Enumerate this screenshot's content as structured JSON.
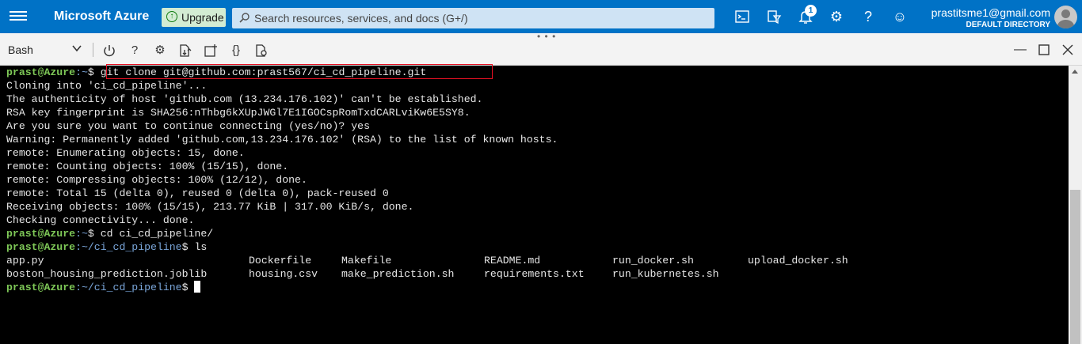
{
  "topbar": {
    "brand": "Microsoft Azure",
    "upgrade_label": "Upgrade",
    "search_placeholder": "Search resources, services, and docs (G+/)",
    "notification_count": "1",
    "account_email": "prastitsme1@gmail.com",
    "account_directory": "DEFAULT DIRECTORY",
    "icons": [
      "menu-icon",
      "cloud-shell-icon",
      "directory-filter-icon",
      "notifications-icon",
      "settings-icon",
      "help-icon",
      "feedback-icon",
      "avatar"
    ]
  },
  "shell": {
    "selected_shell": "Bash",
    "tools": [
      "power-icon",
      "help-icon",
      "settings-icon",
      "upload-download-icon",
      "new-session-icon",
      "editor-braces-icon",
      "web-preview-icon"
    ],
    "window_controls": [
      "minimize-icon",
      "maximize-icon",
      "close-icon"
    ]
  },
  "terminal": {
    "prompt_user": "prast@Azure",
    "home_path": ":~",
    "repo_path": ":~/ci_cd_pipeline",
    "cmd_clone": "git clone git@github.com:prast567/ci_cd_pipeline.git",
    "output": [
      "Cloning into 'ci_cd_pipeline'...",
      "The authenticity of host 'github.com (13.234.176.102)' can't be established.",
      "RSA key fingerprint is SHA256:nThbg6kXUpJWGl7E1IGOCspRomTxdCARLviKw6E5SY8.",
      "Are you sure you want to continue connecting (yes/no)? yes",
      "Warning: Permanently added 'github.com,13.234.176.102' (RSA) to the list of known hosts.",
      "remote: Enumerating objects: 15, done.",
      "remote: Counting objects: 100% (15/15), done.",
      "remote: Compressing objects: 100% (12/12), done.",
      "remote: Total 15 (delta 0), reused 0 (delta 0), pack-reused 0",
      "Receiving objects: 100% (15/15), 213.77 KiB | 317.00 KiB/s, done.",
      "Checking connectivity... done."
    ],
    "cmd_cd": "cd ci_cd_pipeline/",
    "cmd_ls": "ls",
    "files_row1": [
      "app.py",
      "Dockerfile",
      "Makefile",
      "README.md",
      "run_docker.sh",
      "upload_docker.sh"
    ],
    "files_row2": [
      "boston_housing_prediction.joblib",
      "housing.csv",
      "make_prediction.sh",
      "requirements.txt",
      "run_kubernetes.sh"
    ]
  },
  "colors": {
    "azure_blue": "#0072c6",
    "prompt_user": "#7ec857",
    "prompt_path": "#7aa6da",
    "highlight_box": "#e81123"
  }
}
